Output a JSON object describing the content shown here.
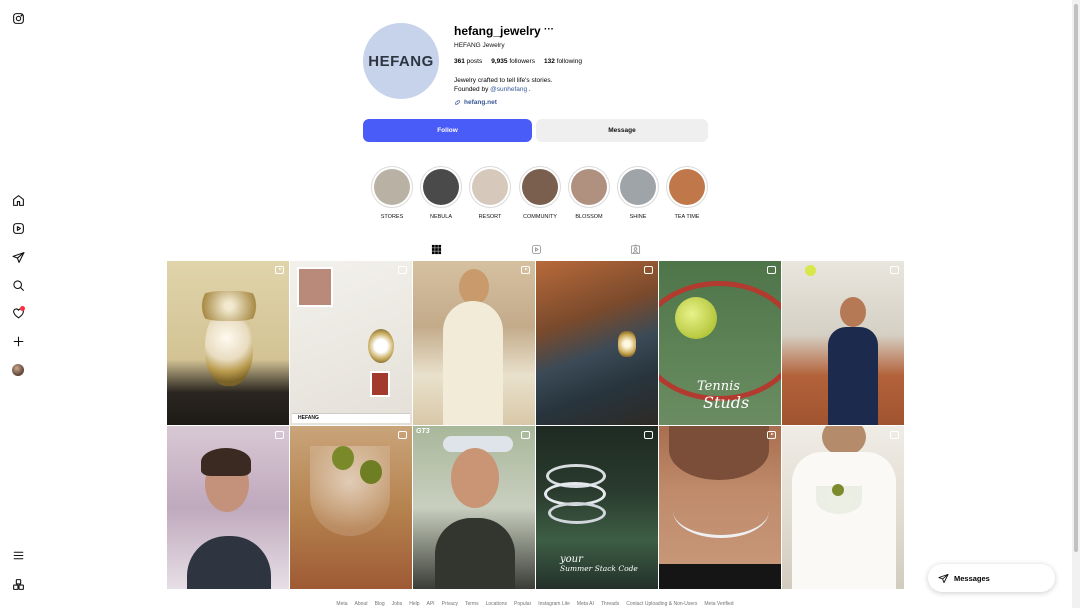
{
  "profile": {
    "avatar_text": "HEFANG",
    "username": "hefang_jewelry",
    "more": "···",
    "full_name": "HEFANG Jewelry",
    "stats": {
      "posts_count": "361",
      "posts_label": "posts",
      "followers_count": "9,935",
      "followers_label": "followers",
      "following_count": "132",
      "following_label": "following"
    },
    "bio_line1": "Jewelry crafted to tell life's stories.",
    "bio_line2_prefix": "Founded by ",
    "bio_mention": "@sunhefang",
    "bio_line2_suffix": " .",
    "website": "hefang.net"
  },
  "actions": {
    "follow": "Follow",
    "message": "Message"
  },
  "highlights": [
    {
      "label": "STORES",
      "color": "#b9b2a4"
    },
    {
      "label": "NEBULA",
      "color": "#4a4a4a"
    },
    {
      "label": "RESORT",
      "color": "#d6c8bb"
    },
    {
      "label": "COMMUNITY",
      "color": "#7a5e4e"
    },
    {
      "label": "BLOSSOM",
      "color": "#b0907e"
    },
    {
      "label": "SHINE",
      "color": "#9fa4a9"
    },
    {
      "label": "TEA TIME",
      "color": "#c0774a"
    }
  ],
  "tabs": [
    {
      "name": "grid-tab-icon"
    },
    {
      "name": "reels-tab-icon"
    },
    {
      "name": "tagged-tab-icon"
    }
  ],
  "posts": [
    {
      "bg": "#d8c9a0",
      "badge": "reel"
    },
    {
      "bg": "#e7e3dc",
      "badge": "carousel",
      "caption": "HEFANG"
    },
    {
      "bg": "#c9b59a",
      "badge": "reel"
    },
    {
      "bg": "#6b4a32",
      "badge": "carousel"
    },
    {
      "bg": "#5e7a55",
      "badge": "carousel",
      "caption1": "Tennis",
      "caption2": "Studs"
    },
    {
      "bg": "#a0542f",
      "badge": "carousel"
    },
    {
      "bg": "#c4b0b8",
      "badge": "carousel"
    },
    {
      "bg": "#a8683f",
      "badge": "carousel"
    },
    {
      "bg": "#b9c2a8",
      "badge": "carousel",
      "caption": "GT3"
    },
    {
      "bg": "#2b3a2c",
      "badge": "carousel",
      "caption1": "your",
      "caption2": "Summer Stack Code"
    },
    {
      "bg": "#b07a5c",
      "badge": "reel"
    },
    {
      "bg": "#e3ded3",
      "badge": "carousel"
    }
  ],
  "footer": [
    "Meta",
    "About",
    "Blog",
    "Jobs",
    "Help",
    "API",
    "Privacy",
    "Terms",
    "Locations",
    "Popular",
    "Instagram Lite",
    "Meta AI",
    "Threads",
    "Contact Uploading & Non-Users",
    "Meta Verified"
  ],
  "messages_label": "Messages",
  "colors": {
    "accent": "#4a5cf7",
    "link": "#385898",
    "notification": "#ff3040"
  }
}
